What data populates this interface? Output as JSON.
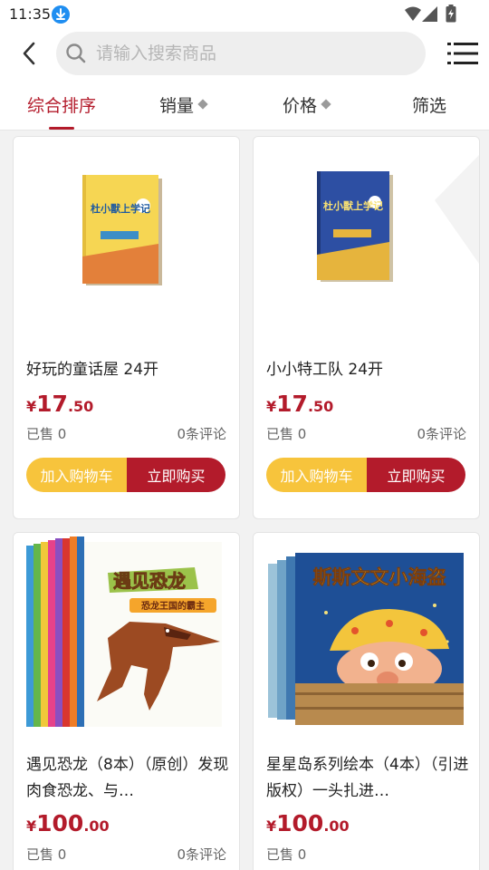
{
  "status_bar": {
    "time": "11:35"
  },
  "search": {
    "placeholder": "请输入搜索商品"
  },
  "sort_tabs": [
    {
      "label": "综合排序"
    },
    {
      "label": "销量"
    },
    {
      "label": "价格"
    },
    {
      "label": "筛选"
    }
  ],
  "products": [
    {
      "cover_text": "杜小獸上学记",
      "title": "好玩的童话屋 24开",
      "price_symbol": "¥",
      "price_int": "17",
      "price_dec": ".50",
      "sold": "已售 0",
      "reviews": "0条评论",
      "add_to_cart": "加入购物车",
      "buy_now": "立即购买"
    },
    {
      "cover_text": "杜小獸上学记",
      "title": "小小特工队 24开",
      "price_symbol": "¥",
      "price_int": "17",
      "price_dec": ".50",
      "sold": "已售 0",
      "reviews": "0条评论",
      "add_to_cart": "加入购物车",
      "buy_now": "立即购买"
    },
    {
      "cover_text": "遇见恐龙",
      "cover_subtext": "恐龙王国的霸主",
      "title": "遇见恐龙（8本）（原创）发现肉食恐龙、与…",
      "price_symbol": "¥",
      "price_int": "100",
      "price_dec": ".00",
      "sold": "已售 0",
      "reviews": "0条评论"
    },
    {
      "cover_text": "斯斯文文小海盗",
      "title": "星星岛系列绘本（4本）（引进版权）一头扎进…",
      "price_symbol": "¥",
      "price_int": "100",
      "price_dec": ".00",
      "sold": "已售 0"
    }
  ]
}
